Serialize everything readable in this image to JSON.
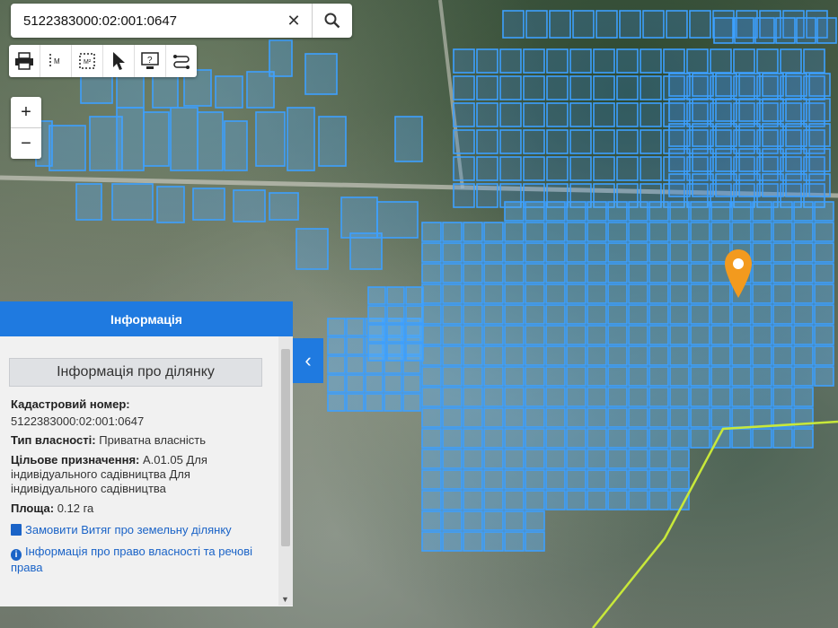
{
  "search": {
    "value": "5122383000:02:001:0647"
  },
  "icons": {
    "clear": "close-icon",
    "search": "search-icon",
    "tools": [
      "printer-icon",
      "measure-line-icon",
      "measure-area-icon",
      "pointer-icon",
      "info-query-icon",
      "route-icon"
    ]
  },
  "zoom": {
    "in": "+",
    "out": "−"
  },
  "panel": {
    "header": "Інформація",
    "section_title": "Інформація про ділянку",
    "cadastral_label": "Кадастровий номер:",
    "cadastral_value": "5122383000:02:001:0647",
    "ownership_label": "Тип власності:",
    "ownership_value": "Приватна власність",
    "purpose_label": "Цільове призначення:",
    "purpose_value": "А.01.05 Для індивідуального садівництва Для індивідуального садівництва",
    "area_label": "Площа:",
    "area_value": "0.12 га",
    "link_extract": "Замовити Витяг про земельну ділянку",
    "link_rights": "Інформація про право власності та речові права"
  },
  "colors": {
    "accent": "#1f7ae0",
    "parcel_stroke": "#3da0ff",
    "marker": "#f39a1e",
    "boundary": "#c8e83a"
  }
}
